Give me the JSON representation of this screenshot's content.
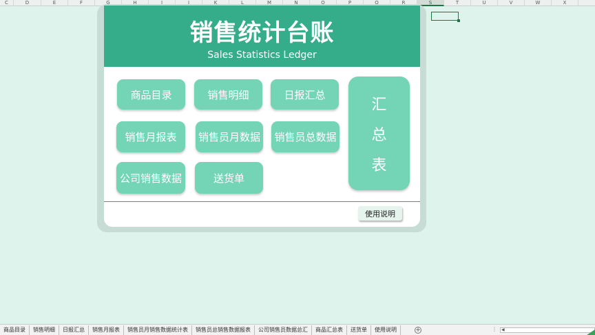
{
  "columns": [
    "C",
    "D",
    "E",
    "F",
    "G",
    "H",
    "I",
    "J",
    "K",
    "L",
    "M",
    "N",
    "O",
    "P",
    "Q",
    "R",
    "S",
    "T",
    "U",
    "V",
    "W",
    "X"
  ],
  "active_column": "S",
  "dashboard": {
    "title": "销售统计台账",
    "subtitle": "Sales Statistics Ledger",
    "buttons": [
      {
        "label": "商品目录"
      },
      {
        "label": "销售明细"
      },
      {
        "label": "日报汇总"
      },
      {
        "label": "销售月报表"
      },
      {
        "label": "销售员月数据"
      },
      {
        "label": "销售员总数据"
      },
      {
        "label": "公司销售数据"
      },
      {
        "label": "送货单"
      }
    ],
    "summary_button": {
      "chars": [
        "汇",
        "总",
        "表"
      ]
    },
    "help_button": "使用说明",
    "colors": {
      "banner": "#35ad8b",
      "button": "#74d4b6",
      "background": "#ddf3ec"
    }
  },
  "sheet_tabs": [
    "商品目录",
    "销售明细",
    "日报汇总",
    "销售月报表",
    "销售员月销售数据统计表",
    "销售员总销售数据报表",
    "公司销售员数据总汇",
    "商品汇总表",
    "送货单",
    "使用说明"
  ],
  "add_sheet_icon": "plus-circle-icon",
  "scroll_indicator": "⋮"
}
